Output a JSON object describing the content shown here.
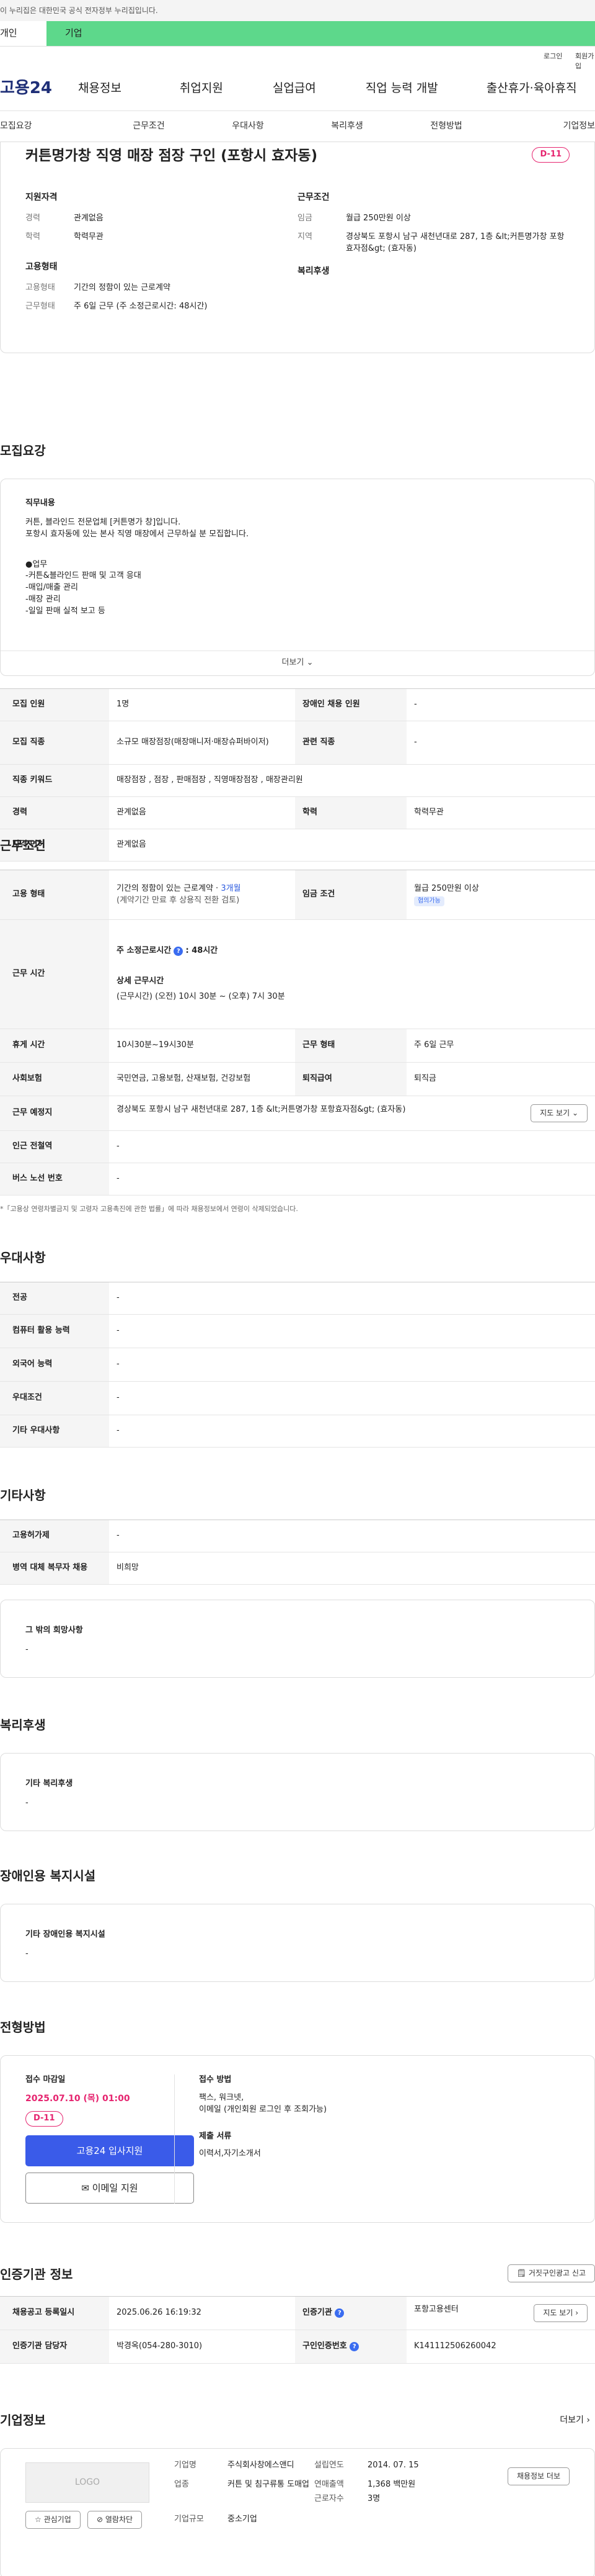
{
  "gov_bar": {
    "text": "이 누리집은 대한민국 공식 전자정부 누리집입니다."
  },
  "tabs": {
    "individual": "개인",
    "corporate": "기업"
  },
  "util": {
    "login": "로그인",
    "join": "회원가입"
  },
  "gnb": {
    "logo": "고용24",
    "menus": [
      "채용정보",
      "취업지원",
      "실업급여",
      "직업 능력 개발",
      "출산휴가·육아휴직"
    ]
  },
  "subnav": [
    "모집요강",
    "근무조건",
    "우대사항",
    "복리후생",
    "전형방법",
    "기업정보"
  ],
  "summary": {
    "title": "커튼명가창 직영 매장 점장 구인 (포항시 효자동)",
    "dday": "D-11",
    "qual": {
      "heading": "지원자격",
      "career_k": "경력",
      "career_v": "관계없음",
      "edu_k": "학력",
      "edu_v": "학력무관"
    },
    "cond": {
      "heading": "근무조건",
      "pay_k": "임금",
      "pay_v": "월급 250만원 이상",
      "loc_k": "지역",
      "loc_v": "경상북도 포항시 남구 새천년대로 287, 1층 &lt;커튼명가창 포항효자점&gt; (효자동)"
    },
    "emp": {
      "heading": "고용형태",
      "type_k": "고용형태",
      "type_v": "기간의 정함이 있는 근로계약",
      "hours_k": "근무형태",
      "hours_v": "주 6일 근무 (주 소정근로시간: 48시간)"
    },
    "welfare": {
      "heading": "복리후생"
    }
  },
  "recruit": {
    "title": "모집요강",
    "desc_heading": "직무내용",
    "desc_lines": [
      "커튼, 블라인드 전문업체 [커튼명가 창]입니다.",
      "포항시 효자동에 있는 본사 직영 매장에서 근무하실 분 모집합니다."
    ],
    "duty_head": "●업무",
    "duty_lines": [
      "-커튼&블라인드 판매 및 고객 응대",
      "-매입/매출 관리",
      "-매장 관리",
      "-일일 판매 실적 보고 등"
    ],
    "more": "더보기",
    "rows": [
      {
        "k1": "모집 인원",
        "v1": "1명",
        "k2": "장애인 채용 인원",
        "v2": "-"
      },
      {
        "k1": "모집 직종",
        "v1": "소규모 매장점장(매장매니저·매장슈퍼바이저)",
        "k2": "관련 직종",
        "v2": "-"
      },
      {
        "k1": "직종 키워드",
        "v1": "매장점장 , 점장 , 판매점장 , 직영매장점장 , 매장관리원"
      },
      {
        "k1": "경력",
        "v1": "관계없음",
        "k2": "학력",
        "v2": "학력무관"
      },
      {
        "k1": "자격 면허",
        "v1": "관계없음"
      }
    ]
  },
  "work": {
    "title": "근무조건",
    "emp_k": "고용 형태",
    "emp_v": "기간의 정함이 있는 근로계약 · ",
    "emp_period": "3개월",
    "emp_sub": "(계약기간 만료 후 상용직 전환 검토)",
    "pay_k": "임금 조건",
    "pay_v": "월급 250만원 이상",
    "pay_badge": "협의가능",
    "hours_k": "근무 시간",
    "hours_total": "주 소정근로시간",
    "hours_total_v": ": 48시간",
    "hours_detail_h": "상세 근무시간",
    "hours_detail": "(근무시간) (오전) 10시 30분 ~ (오후) 7시 30분",
    "break_k": "휴게 시간",
    "break_v": "10시30분~19시30분",
    "form_k": "근무 형태",
    "form_v": "주 6일 근무",
    "ins_k": "사회보험",
    "ins_v": "국민연금, 고용보험, 산재보험, 건강보험",
    "sev_k": "퇴직급여",
    "sev_v": "퇴직금",
    "place_k": "근무 예정지",
    "place_v": "경상북도 포항시 남구 새천년대로 287, 1층 &lt;커튼명가창 포항효자점&gt; (효자동)",
    "map_btn": "지도 보기",
    "subway_k": "인근 전철역",
    "subway_v": "-",
    "bus_k": "버스 노선 번호",
    "bus_v": "-",
    "note": "*「고용상 연령차별금지 및 고령자 고용촉진에 관한 법률」에 따라 채용정보에서 연령이 삭제되었습니다."
  },
  "pref": {
    "title": "우대사항",
    "rows": [
      {
        "k": "전공",
        "v": "-"
      },
      {
        "k": "컴퓨터 활용 능력",
        "v": "-"
      },
      {
        "k": "외국어 능력",
        "v": "-"
      },
      {
        "k": "우대조건",
        "v": "-"
      },
      {
        "k": "기타 우대사항",
        "v": "-"
      }
    ]
  },
  "etc": {
    "title": "기타사항",
    "rows": [
      {
        "k": "고용허가제",
        "v": "-"
      },
      {
        "k": "병역 대체 복무자 채용",
        "v": "비희망"
      }
    ],
    "hope_h": "그 밖의 희망사항",
    "hope_v": "-"
  },
  "welfare": {
    "title": "복리후생",
    "h": "기타 복리후생",
    "v": "-"
  },
  "disab": {
    "title": "장애인용 복지시설",
    "h": "기타 장애인용 복지시설",
    "v": "-"
  },
  "method": {
    "title": "전형방법",
    "deadline_h": "접수 마감일",
    "deadline_v": "2025.07.10 (목) 01:00",
    "dday": "D-11",
    "apply_btn": "고용24 입사지원",
    "email_btn": "이메일 지원",
    "way_h": "접수 방법",
    "way_v1": "팩스, 워크넷,",
    "way_v2": "이메일 (개인회원 로그인 후 조회가능)",
    "doc_h": "제출 서류",
    "doc_v": "이력서,자기소개서"
  },
  "cert": {
    "title": "인증기관 정보",
    "report_btn": "거짓구인광고 신고",
    "reg_k": "채용공고 등록일시",
    "reg_v": "2025.06.26 16:19:32",
    "org_k": "인증기관",
    "org_v": "포항고용센터",
    "org_btn": "지도 보기",
    "mgr_k": "인증기관 담당자",
    "mgr_v": "박경옥(054-280-3010)",
    "no_k": "구인인증번호",
    "no_v": "K141112506260042"
  },
  "company": {
    "title": "기업정보",
    "more": "더보기",
    "logo": "LOGO",
    "fav_btn": "관심기업",
    "block_btn": "열람차단",
    "name_k": "기업명",
    "name_v": "주식회사창에스앤디",
    "biz_k": "업종",
    "biz_v": "커튼 및 침구류통 도매업",
    "size_k": "기업규모",
    "size_v": "중소기업",
    "est_k": "설립연도",
    "est_v": "2014. 07. 15",
    "sales_k": "연매출액",
    "sales_v": "1,368 백만원",
    "emp_k": "근로자수",
    "emp_v": "3명",
    "jobs_btn": "채용정보 더보"
  },
  "colors": {
    "accent": "#3a5be9",
    "dday": "#e6246f",
    "corp_tab": "#5dd88b",
    "logo": "#1f2f77"
  }
}
